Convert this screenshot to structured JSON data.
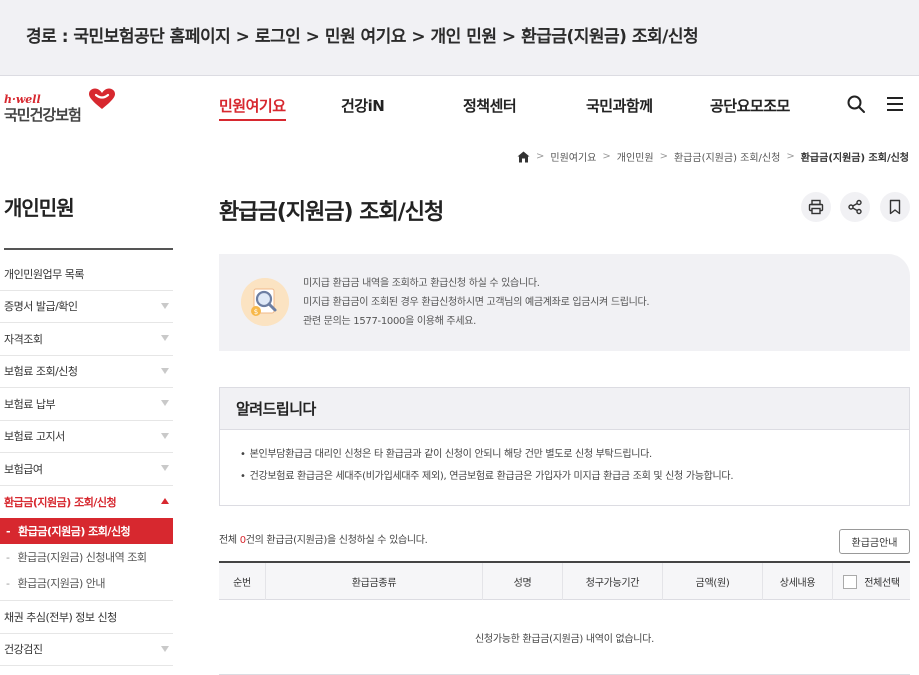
{
  "path_banner": {
    "text": "경로 : 국민보험공단 홈페이지 > 로그인 > 민원 여기요 > 개인 민원 > 환급금(지원금) 조회/신청"
  },
  "logo": {
    "tagline": "h·well",
    "name": "국민건강보험"
  },
  "gnb": {
    "items": [
      {
        "label": "민원여기요",
        "active": true
      },
      {
        "label": "건강iN",
        "active": false
      },
      {
        "label": "정책센터",
        "active": false
      },
      {
        "label": "국민과함께",
        "active": false
      },
      {
        "label": "공단요모조모",
        "active": false
      }
    ]
  },
  "header_icons": {
    "search": "search-icon",
    "menu": "hamburger-menu-icon"
  },
  "breadcrumb": {
    "home_icon": "home-icon",
    "items": [
      "민원여기요",
      "개인민원",
      "환급금(지원금) 조회/신청"
    ],
    "current": "환급금(지원금) 조회/신청"
  },
  "sidebar": {
    "title": "개인민원",
    "items": [
      {
        "label": "개인민원업무 목록",
        "arrow": false
      },
      {
        "label": "증명서 발급/확인",
        "arrow": true
      },
      {
        "label": "자격조회",
        "arrow": true
      },
      {
        "label": "보험료 조회/신청",
        "arrow": true
      },
      {
        "label": "보험료 납부",
        "arrow": true
      },
      {
        "label": "보험료 고지서",
        "arrow": true
      },
      {
        "label": "보험급여",
        "arrow": true
      },
      {
        "label": "환급금(지원금) 조회/신청",
        "arrow": true,
        "open": true
      }
    ],
    "sub_items": [
      {
        "label": "환급금(지원금) 조회/신청",
        "active": true
      },
      {
        "label": "환급금(지원금) 신청내역 조회",
        "active": false
      },
      {
        "label": "환급금(지원금) 안내",
        "active": false
      }
    ],
    "after_items": [
      {
        "label": "채권 추심(전부) 정보 신청",
        "arrow": false
      },
      {
        "label": "건강검진",
        "arrow": true
      }
    ]
  },
  "main": {
    "title": "환급금(지원금) 조회/신청",
    "tools": [
      "print-icon",
      "share-icon",
      "bookmark-icon"
    ],
    "info_lines": [
      "미지급 환급금 내역을 조회하고 환급신청 하실 수 있습니다.",
      "미지급 환급금이 조회된 경우 환급신청하시면 고객님의 예금계좌로 입금시켜 드립니다.",
      "관련 문의는 1577-1000을 이용해 주세요."
    ],
    "notice": {
      "title": "알려드립니다",
      "lines": [
        "본인부담환급금 대리인 신청은 타 환급금과 같이 신청이 안되니 해당 건만 별도로 신청 부탁드립니다.",
        "건강보험료 환급금은 세대주(비가입세대주 제외), 연금보험료 환급금은 가입자가 미지급 환급금 조회 및 신청 가능합니다."
      ]
    },
    "count": {
      "prefix": "전체 ",
      "num": "0",
      "suffix": "건의 환급금(지원금)을 신청하실 수 있습니다."
    },
    "guide_button": "환급금안내",
    "table": {
      "headers": [
        "순번",
        "환급금종류",
        "성명",
        "청구가능기간",
        "금액(원)",
        "상세내용",
        "전체선택"
      ],
      "empty_text": "신청가능한 환급금(지원금) 내역이 없습니다."
    }
  },
  "colors": {
    "accent": "#d7282f",
    "panel": "#f1f1f4"
  }
}
